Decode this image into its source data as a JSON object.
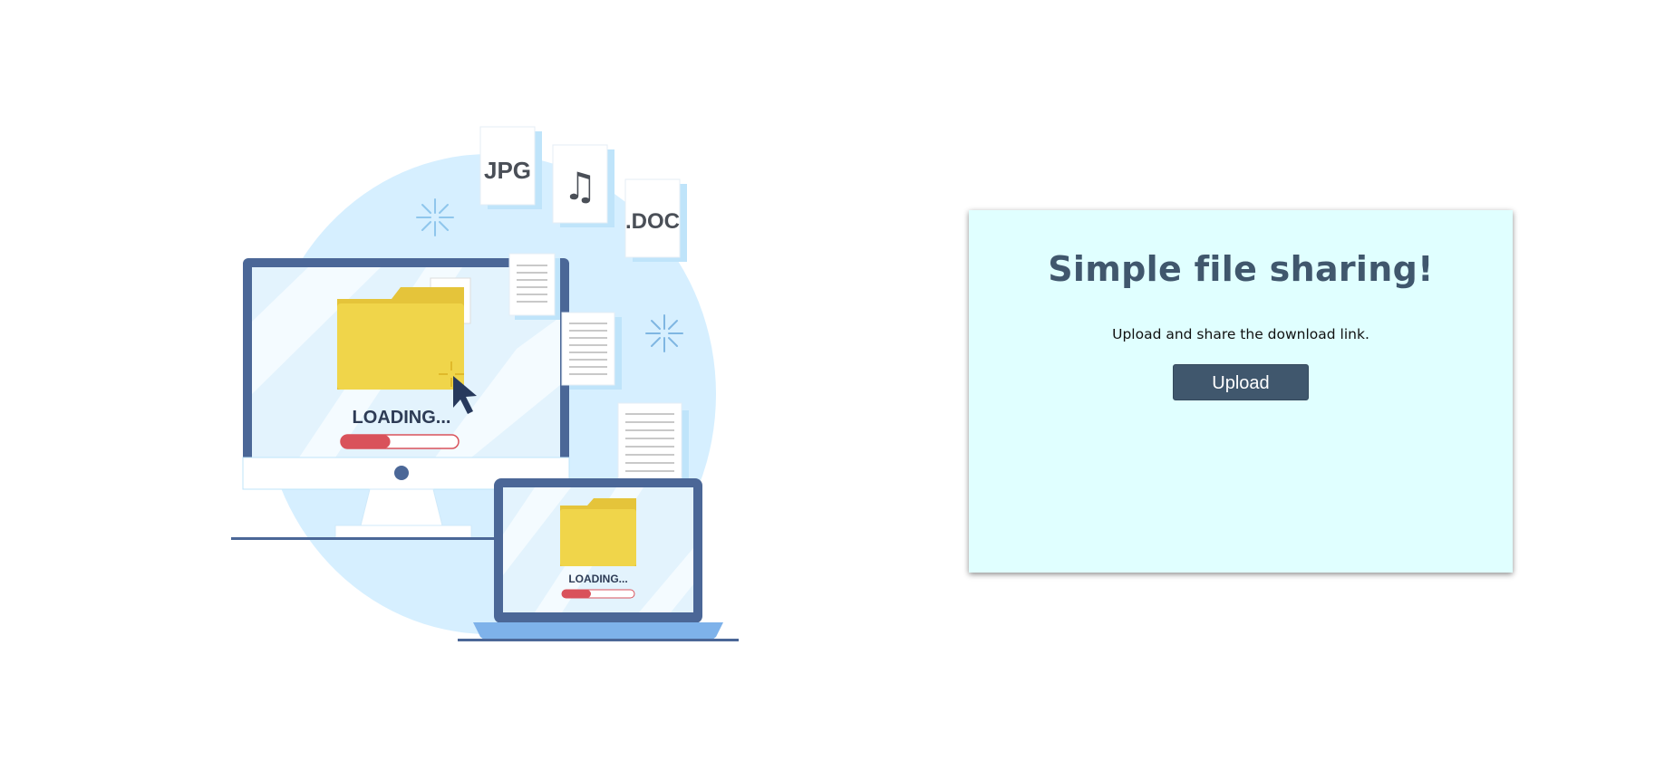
{
  "illustration": {
    "file_labels": [
      "JPG",
      ".DOC"
    ],
    "monitor_status": "LOADING...",
    "laptop_status": "LOADING...",
    "monitor_progress": 0.42,
    "laptop_progress": 0.4
  },
  "card": {
    "title": "Simple file sharing!",
    "subtitle": "Upload and share the download link.",
    "upload_label": "Upload"
  },
  "colors": {
    "card_background": "#e0ffff",
    "title_color": "#40576d",
    "button_background": "#40576d",
    "folder_yellow": "#f0d54a",
    "progress_red": "#d9525b",
    "device_blue": "#4b6797",
    "circle_light_blue": "#d6efff"
  }
}
